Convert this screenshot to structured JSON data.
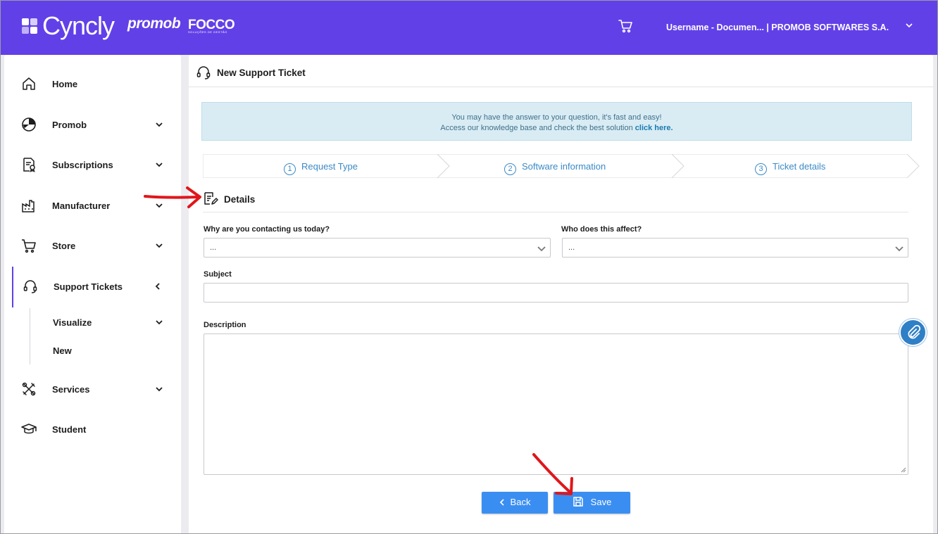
{
  "topbar": {
    "brand_name": "Cyncly",
    "brand_promob": "promob",
    "brand_focco": "FOCCO",
    "brand_focco_sub": "SOLUÇÕES DE GESTÃO",
    "user_label": "Username - Documen...  |  PROMOB SOFTWARES S.A.",
    "icons": [
      "cyncly-logo-icon",
      "cart-icon",
      "chevron-down-icon"
    ],
    "color": "#6240e8"
  },
  "sidebar": {
    "items": [
      {
        "label": "Home",
        "icon": "home-icon"
      },
      {
        "label": "Promob",
        "icon": "promob-icon"
      },
      {
        "label": "Subscriptions",
        "icon": "subscriptions-icon"
      },
      {
        "label": "Manufacturer",
        "icon": "factory-icon"
      },
      {
        "label": "Store",
        "icon": "cart-icon"
      },
      {
        "label": "Support Tickets",
        "icon": "headset-icon"
      },
      {
        "label": "Services",
        "icon": "tools-icon"
      },
      {
        "label": "Student",
        "icon": "graduation-cap-icon"
      }
    ],
    "sub_items": [
      {
        "label": "Visualize"
      },
      {
        "label": "New"
      }
    ]
  },
  "main": {
    "title": "New Support Ticket",
    "info_line1": "You may have the answer to your question, it's fast and easy!",
    "info_line2": "Access our knowledge base and check the best solution ",
    "info_link": "click here.",
    "steps": [
      {
        "num": "1",
        "label": "Request Type"
      },
      {
        "num": "2",
        "label": "Software information"
      },
      {
        "num": "3",
        "label": "Ticket details"
      }
    ],
    "details_title": "Details",
    "form": {
      "reason_label": "Why are you contacting us today?",
      "reason_value": "...",
      "affect_label": "Who does this affect?",
      "affect_value": "...",
      "subject_label": "Subject",
      "subject_value": "",
      "description_label": "Description",
      "description_value": ""
    },
    "buttons": {
      "back_label": "Back",
      "save_label": "Save"
    }
  },
  "colors": {
    "accent": "#6240e8",
    "button": "#3b8ef1",
    "step": "#3a8ac6",
    "info_bg": "#d9ecf4",
    "annotation_arrow": "#e0161b"
  }
}
